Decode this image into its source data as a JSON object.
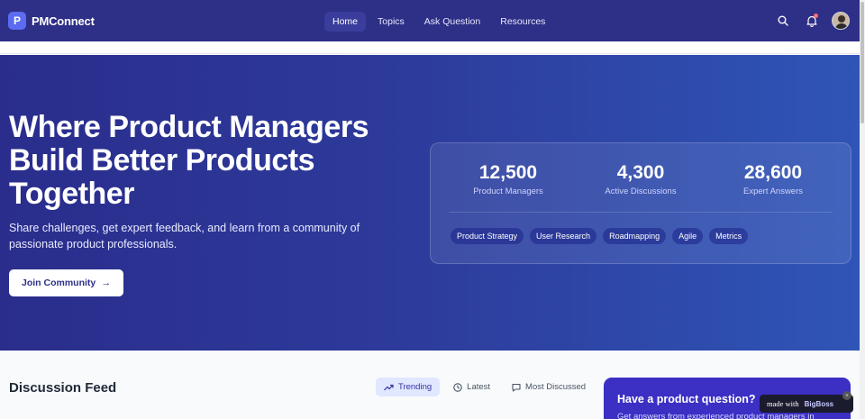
{
  "nav": {
    "brand_letter": "P",
    "brand_name": "PMConnect",
    "links": [
      "Home",
      "Topics",
      "Ask Question",
      "Resources"
    ]
  },
  "hero": {
    "title": "Where Product Managers Build Better Products Together",
    "subtitle": "Share challenges, get expert feedback, and learn from a community of passionate product professionals.",
    "cta": "Join Community"
  },
  "stats": [
    {
      "value": "12,500",
      "label": "Product Managers"
    },
    {
      "value": "4,300",
      "label": "Active Discussions"
    },
    {
      "value": "28,600",
      "label": "Expert Answers"
    }
  ],
  "tags": [
    "Product Strategy",
    "User Research",
    "Roadmapping",
    "Agile",
    "Metrics"
  ],
  "feed": {
    "title": "Discussion Feed",
    "tabs": [
      "Trending",
      "Latest",
      "Most Discussed"
    ]
  },
  "question_card": {
    "title": "Have a product question?",
    "subtitle": "Get answers from experienced product managers in"
  },
  "badge": {
    "made_with": "made with",
    "logo": "BigBoss"
  },
  "colors": {
    "nav_bg": "#2e2f86",
    "hero_start": "#2a2d8c",
    "hero_end": "#2f55b7",
    "accent": "#3b2fc4"
  }
}
